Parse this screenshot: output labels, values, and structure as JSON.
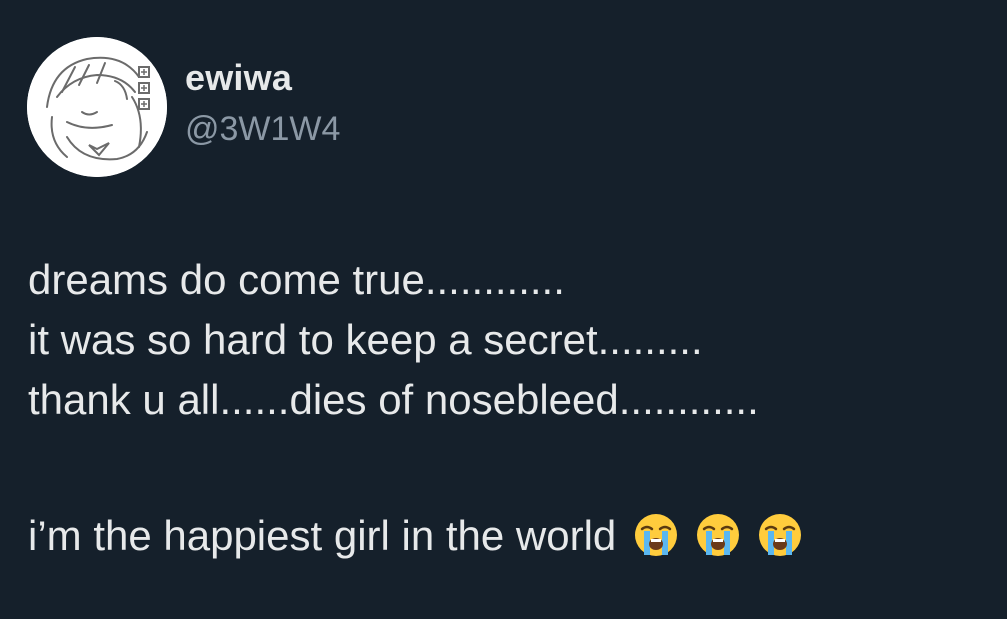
{
  "author": {
    "display_name": "ewiwa",
    "handle": "@3W1W4"
  },
  "tweet": {
    "lines": [
      "dreams do come true............",
      "it was so hard to keep a secret.........",
      "thank u all......dies of nosebleed............",
      "i’m the happiest girl in the world"
    ],
    "emojis": [
      "loudly-crying-face-icon",
      "loudly-crying-face-icon",
      "loudly-crying-face-icon"
    ]
  },
  "colors": {
    "background": "#15202b",
    "text": "#e7e9ea",
    "secondary_text": "#8b98a5"
  }
}
